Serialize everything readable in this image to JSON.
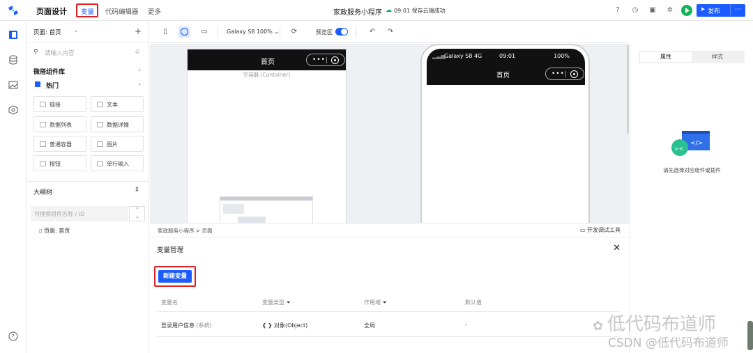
{
  "topbar": {
    "title": "页面设计",
    "tabs": [
      "变量",
      "代码编辑器",
      "更多"
    ],
    "app_name": "家政服务小程序",
    "save_status": "09:01  保存云端成功",
    "publish": "发布",
    "more": "···"
  },
  "left_panel": {
    "page_selector": "页面: 首页",
    "search_placeholder": "请输入内容",
    "library_title": "微搭组件库",
    "hot_title": "热门",
    "components": [
      "链接",
      "文本",
      "数据列表",
      "数据详情",
      "普通容器",
      "图片",
      "按钮",
      "单行输入"
    ],
    "outline_title": "大纲树",
    "outline_search_placeholder": "可搜索组件名称 / ID",
    "tree_item": "页面: 首页"
  },
  "toolbar": {
    "device": "Galaxy S8 100%",
    "preview_label": "预览区"
  },
  "canvas": {
    "page_title": "首页",
    "container_placeholder": "空容器 (Container)",
    "phone_carrier": "Galaxy S8  4G",
    "phone_time": "09:01",
    "phone_battery": "100%",
    "phone_title": "首页"
  },
  "drawer": {
    "breadcrumb": "家政服务小程序  >  页面",
    "devtools": "开发调试工具",
    "title": "变量管理",
    "new_button": "新建变量",
    "columns": [
      "变量名",
      "变量类型",
      "作用域",
      "默认值"
    ],
    "row": {
      "name": "登录用户信息",
      "system": "(系统)",
      "type": "对象(Object)",
      "scope": "全局",
      "default": "-"
    }
  },
  "right_panel": {
    "tabs": [
      "属性",
      "样式"
    ],
    "empty_text": "请先选择对应组件或插件"
  },
  "watermark": {
    "line1": "低代码布道师",
    "line2": "CSDN @低代码布道师"
  },
  "colors": {
    "accent": "#1a5cff",
    "highlight": "#e02020",
    "run": "#14b35a"
  }
}
